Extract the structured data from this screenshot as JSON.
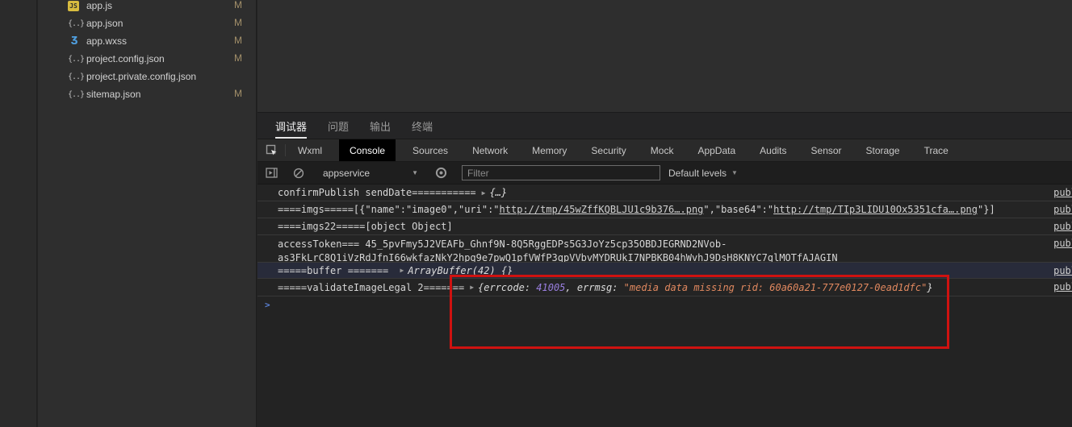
{
  "sidebar": {
    "files": [
      {
        "name": "app.js",
        "icon": "js",
        "icon_glyph": "JS",
        "badge": "M"
      },
      {
        "name": "app.json",
        "icon": "json",
        "icon_glyph": "{..}",
        "badge": "M"
      },
      {
        "name": "app.wxss",
        "icon": "wxss",
        "icon_glyph": "Ʒ",
        "badge": "M"
      },
      {
        "name": "project.config.json",
        "icon": "json",
        "icon_glyph": "{..}",
        "badge": "M"
      },
      {
        "name": "project.private.config.json",
        "icon": "json",
        "icon_glyph": "{..}",
        "badge": ""
      },
      {
        "name": "sitemap.json",
        "icon": "json",
        "icon_glyph": "{..}",
        "badge": "M"
      }
    ]
  },
  "debugger_panel": {
    "tabs": [
      {
        "label": "调试器",
        "active": true
      },
      {
        "label": "问题",
        "active": false
      },
      {
        "label": "输出",
        "active": false
      },
      {
        "label": "终端",
        "active": false
      }
    ]
  },
  "devtools": {
    "tabs": [
      "Wxml",
      "Console",
      "Sources",
      "Network",
      "Memory",
      "Security",
      "Mock",
      "AppData",
      "Audits",
      "Sensor",
      "Storage",
      "Trace"
    ],
    "active_tab": "Console"
  },
  "toolbar": {
    "context_value": "appservice",
    "dropdown_arrow": "▼",
    "filter_placeholder": "Filter",
    "levels_label": "Default levels",
    "levels_arrow": "▼"
  },
  "console": {
    "expand_arrow": "▶",
    "source_link": "publ",
    "rows": {
      "r1": {
        "label": "confirmPublish sendDate===========",
        "preview": "{…}"
      },
      "r2": {
        "pre": "====imgs=====[{\"name\":\"image0\",\"uri\":\"",
        "url1": "http://tmp/45wZffKQBLJU1c9b376….png",
        "mid": "\",\"base64\":\"",
        "url2": "http://tmp/TIp3LIDU10Ox5351cfa….png",
        "post": "\"}]"
      },
      "r3": {
        "label": "====imgs22=====[object Object]"
      },
      "r4": {
        "line1": "accessToken=== 45_5pvFmy5J2VEAFb_Ghnf9N-8Q5RggEDPs5G3JoYz5cp35OBDJEGRND2NVob-",
        "line2": "as3FkLrC8Q1iVzRdJfnI66wkfazNkY2hpq9e7pwQ1pfVWfP3qpVVbvMYDRUkI7NPBKB04hWvhJ9DsH8KNYC7glMOTfAJAGIN"
      },
      "r5": {
        "label": "=====buffer ======= ",
        "preview": "ArrayBuffer(42) {}"
      },
      "r6": {
        "label": "=====validateImageLegal 2=======",
        "obj_open": "{errcode: ",
        "errcode": "41005",
        "obj_mid": ", errmsg: ",
        "errmsg": "\"media data missing rid: 60a60a21-777e0127-0ead1dfc\"",
        "obj_close": "}"
      }
    },
    "prompt": ">"
  },
  "annotation": {
    "color": "#cf1210"
  }
}
